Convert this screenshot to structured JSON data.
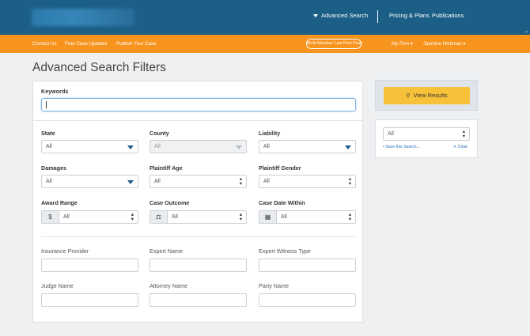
{
  "nav": {
    "advanced_search": "Advanced Search",
    "pricing": "Pricing & Plans",
    "publications": "Publications"
  },
  "subnav": {
    "contact": "Contact Us",
    "free_updates": "Free Case Updates",
    "publish": "Publish Your Case",
    "pill": "Multi-Member Law Firm Pass",
    "my_firm": "My Firm ▾",
    "user": "Jasmine Hickman ▾"
  },
  "page": {
    "title": "Advanced Search Filters"
  },
  "form": {
    "keywords_label": "Keywords",
    "state": {
      "label": "State",
      "value": "All"
    },
    "county": {
      "label": "County",
      "value": "All"
    },
    "liability": {
      "label": "Liability",
      "value": "All"
    },
    "damages": {
      "label": "Damages",
      "value": "All"
    },
    "plaintiff_age": {
      "label": "Plaintiff Age",
      "value": "All"
    },
    "plaintiff_gender": {
      "label": "Plaintiff Gender",
      "value": "All"
    },
    "award_range": {
      "label": "Award Range",
      "value": "All",
      "addon": "$"
    },
    "case_outcome": {
      "label": "Case Outcome",
      "value": "All",
      "addon": "⚖"
    },
    "case_date": {
      "label": "Case Date Within",
      "value": "All",
      "addon": "▦"
    },
    "insurance_provider": "Insurance Provider",
    "expert_name": "Expert Name",
    "expert_witness_type": "Expert Witness Type",
    "judge_name": "Judge Name",
    "attorney_name": "Attorney Name",
    "party_name": "Party Name"
  },
  "sidebar": {
    "view_results": "View Results",
    "saved_value": "All",
    "save_search": "Save this Search...",
    "clear": "Clear"
  },
  "colors": {
    "primary": "#1c5f86",
    "orange": "#f7941d",
    "button": "#f7c23a"
  }
}
